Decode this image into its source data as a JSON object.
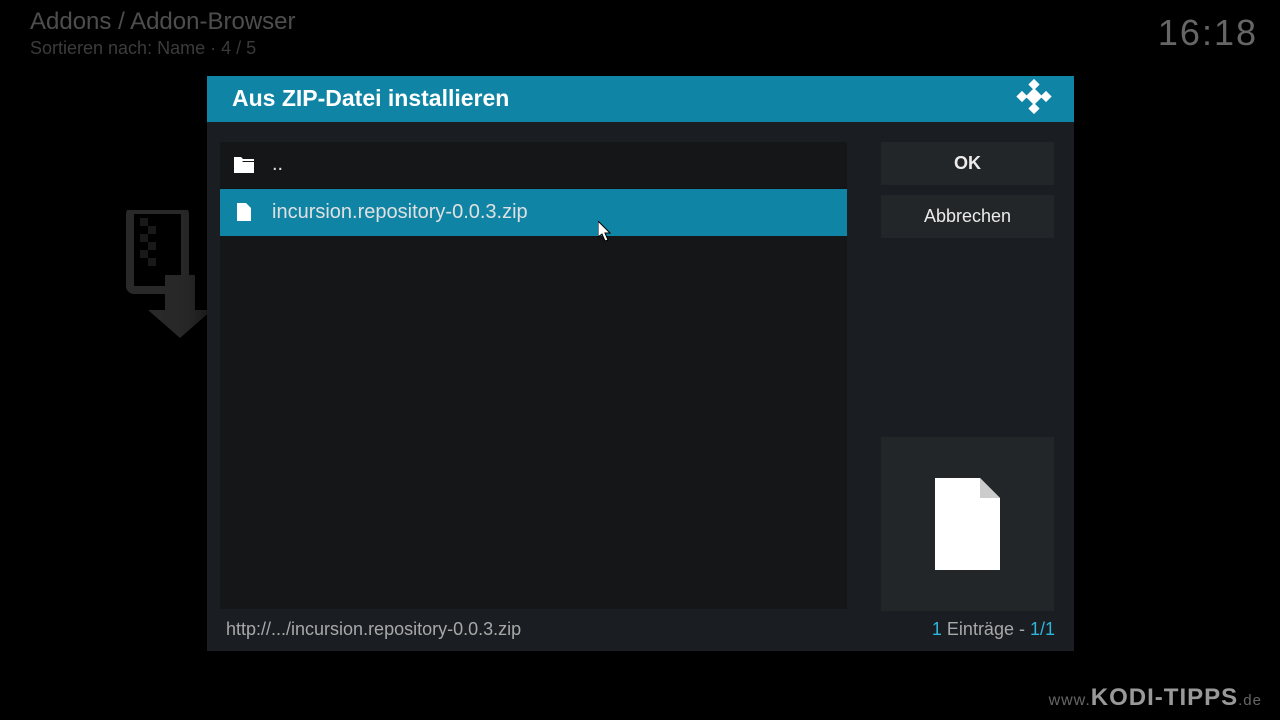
{
  "background": {
    "breadcrumb": "Addons / Addon-Browser",
    "subtitle": "Sortieren nach: Name  ·  4 / 5",
    "clock": "16:18"
  },
  "dialog": {
    "title": "Aus ZIP-Datei installieren",
    "buttons": {
      "ok": "OK",
      "cancel": "Abbrechen"
    },
    "files": {
      "parent": "..",
      "items": [
        {
          "name": "incursion.repository-0.0.3.zip",
          "selected": true
        }
      ]
    },
    "footer": {
      "path": "http://.../incursion.repository-0.0.3.zip",
      "count_num": "1",
      "count_label": " Einträge - ",
      "page": "1/1"
    }
  },
  "watermark": {
    "www": "www.",
    "main": "KODI-TIPPS",
    "tld": ".de"
  }
}
